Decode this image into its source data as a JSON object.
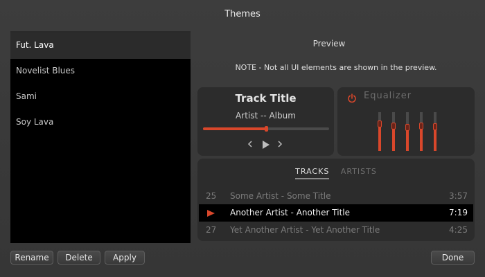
{
  "window": {
    "title": "Themes"
  },
  "themes": {
    "items": [
      {
        "label": "Fut. Lava",
        "selected": true
      },
      {
        "label": "Novelist Blues",
        "selected": false
      },
      {
        "label": "Sami",
        "selected": false
      },
      {
        "label": "Soy Lava",
        "selected": false
      }
    ]
  },
  "preview": {
    "label": "Preview",
    "note": "NOTE - Not all UI elements are shown in the preview.",
    "player": {
      "track_title": "Track Title",
      "artist_album": "Artist -- Album",
      "progress": 0.5,
      "prev_icon": "chevron-left-icon",
      "play_icon": "play-icon",
      "next_icon": "chevron-right-icon"
    },
    "equalizer": {
      "title": "Equalizer",
      "power_icon": "power-icon",
      "bands": [
        0.3,
        0.35,
        0.4,
        0.35,
        0.38
      ]
    },
    "library": {
      "tabs": [
        {
          "label": "Tracks",
          "active": true
        },
        {
          "label": "Artists",
          "active": false
        }
      ],
      "rows": [
        {
          "num": "25",
          "name": "Some Artist - Some Title",
          "duration": "3:57",
          "playing": false
        },
        {
          "num": "",
          "name": "Another Artist - Another Title",
          "duration": "7:19",
          "playing": true
        },
        {
          "num": "27",
          "name": "Yet Another Artist - Yet Another Title",
          "duration": "4:25",
          "playing": false
        }
      ]
    }
  },
  "buttons": {
    "rename": "Rename",
    "delete": "Delete",
    "apply": "Apply",
    "done": "Done"
  },
  "colors": {
    "accent": "#d9472b",
    "background": "#3a3a3a",
    "panel": "#2c2c2c"
  }
}
